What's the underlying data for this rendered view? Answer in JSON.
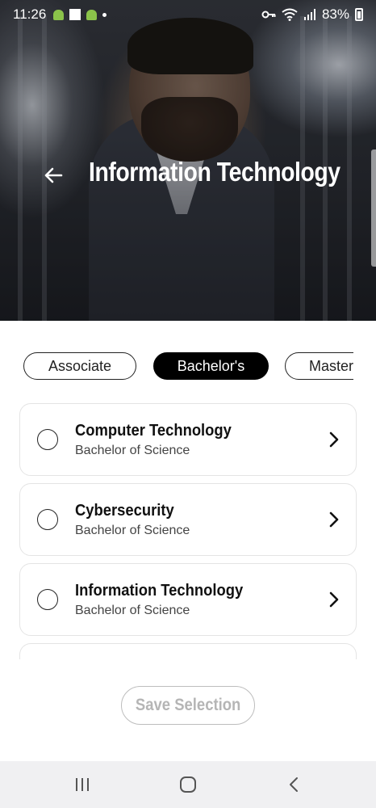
{
  "status_bar": {
    "time": "11:26",
    "battery": "83%"
  },
  "header": {
    "title": "Information Technology"
  },
  "tabs": [
    {
      "label": "Associate",
      "active": false
    },
    {
      "label": "Bachelor's",
      "active": true
    },
    {
      "label": "Master",
      "active": false
    }
  ],
  "programs": [
    {
      "title": "Computer Technology",
      "subtitle": "Bachelor of Science"
    },
    {
      "title": "Cybersecurity",
      "subtitle": "Bachelor of Science"
    },
    {
      "title": "Information Technology",
      "subtitle": "Bachelor of Science"
    }
  ],
  "save_button": {
    "label": "Save Selection"
  },
  "colors": {
    "active_tab_bg": "#000000",
    "disabled_text": "#b5b5b5",
    "nav_bar_bg": "#f0f0f2"
  },
  "icons": {
    "back": "arrow-left-icon",
    "chevron": "chevron-right-icon",
    "nav_recents": "recents-icon",
    "nav_home": "home-icon",
    "nav_back": "back-icon"
  }
}
